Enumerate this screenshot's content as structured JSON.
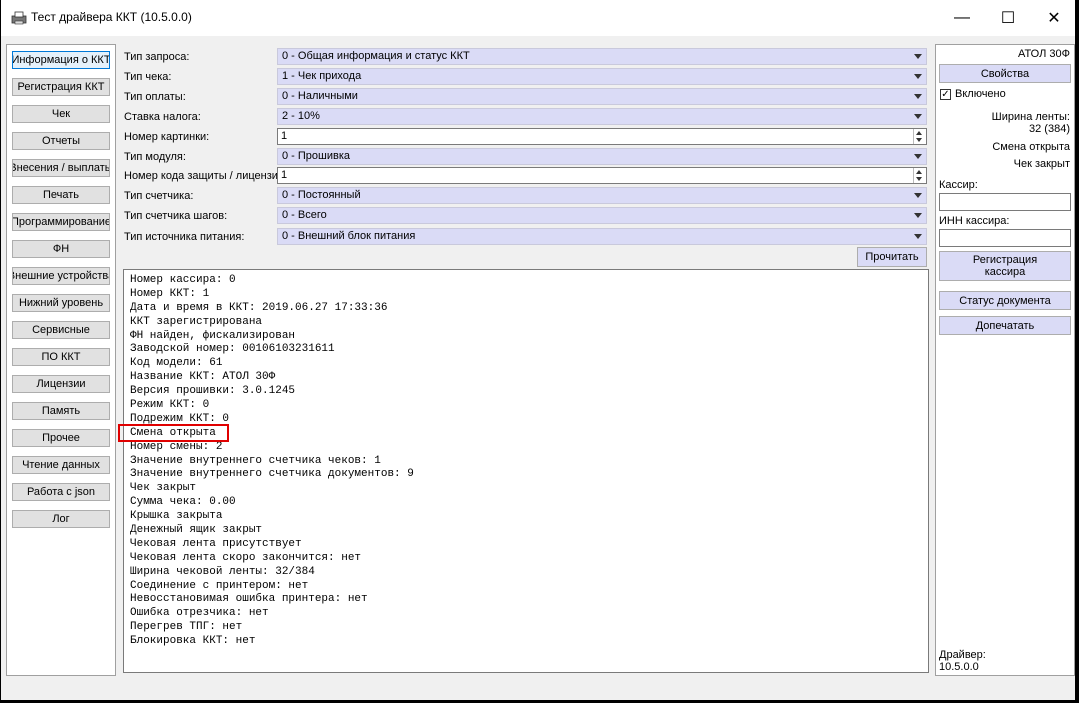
{
  "window": {
    "title": "Тест драйвера ККТ (10.5.0.0)",
    "minimize": "—",
    "maximize": "☐",
    "close": "✕"
  },
  "nav": {
    "items": [
      {
        "label": "Информация о ККТ",
        "active": true
      },
      {
        "label": "Регистрация ККТ"
      },
      {
        "label": "Чек"
      },
      {
        "label": "Отчеты"
      },
      {
        "label": "Внесения / выплаты"
      },
      {
        "label": "Печать"
      },
      {
        "label": "Программирование"
      },
      {
        "label": "ФН"
      },
      {
        "label": "Внешние устройства"
      },
      {
        "label": "Нижний уровень"
      },
      {
        "label": "Сервисные"
      },
      {
        "label": "ПО ККТ"
      },
      {
        "label": "Лицензии"
      },
      {
        "label": "Память"
      },
      {
        "label": "Прочее"
      },
      {
        "label": "Чтение данных"
      },
      {
        "label": "Работа с json"
      },
      {
        "label": "Лог"
      }
    ]
  },
  "form": {
    "fields": [
      {
        "label": "Тип запроса:",
        "value": "0 - Общая информация и статус ККТ",
        "kind": "combo"
      },
      {
        "label": "Тип чека:",
        "value": "1 - Чек прихода",
        "kind": "combo"
      },
      {
        "label": "Тип оплаты:",
        "value": "0 - Наличными",
        "kind": "combo"
      },
      {
        "label": "Ставка налога:",
        "value": "2 - 10%",
        "kind": "combo"
      },
      {
        "label": "Номер картинки:",
        "value": "1",
        "kind": "spin"
      },
      {
        "label": "Тип модуля:",
        "value": "0 - Прошивка",
        "kind": "combo"
      },
      {
        "label": "Номер кода защиты / лицензии:",
        "value": "1",
        "kind": "spin"
      },
      {
        "label": "Тип счетчика:",
        "value": "0 - Постоянный",
        "kind": "combo"
      },
      {
        "label": "Тип счетчика шагов:",
        "value": "0 - Всего",
        "kind": "combo"
      },
      {
        "label": "Тип источника питания:",
        "value": "0 - Внешний блок питания",
        "kind": "combo"
      }
    ],
    "read_button": "Прочитать"
  },
  "output": {
    "lines": [
      "Номер кассира: 0",
      "Номер ККТ: 1",
      "Дата и время в ККТ: 2019.06.27 17:33:36",
      "ККТ зарегистрирована",
      "ФН найден, фискализирован",
      "Заводской номер: 00106103231611",
      "Код модели: 61",
      "Название ККТ: АТОЛ 30Ф",
      "Версия прошивки: 3.0.1245",
      "Режим ККТ: 0",
      "Подрежим ККТ: 0",
      "Смена открыта",
      "Номер смены: 2",
      "Значение внутреннего счетчика чеков: 1",
      "Значение внутреннего счетчика документов: 9",
      "Чек закрыт",
      "Сумма чека: 0.00",
      "Крышка закрыта",
      "Денежный ящик закрыт",
      "Чековая лента присутствует",
      "Чековая лента скоро закончится: нет",
      "Ширина чековой ленты: 32/384",
      "Соединение с принтером: нет",
      "Невосстановимая ошибка принтера: нет",
      "Ошибка отрезчика: нет",
      "Перегрев ТПГ: нет",
      "Блокировка ККТ: нет"
    ],
    "highlight_color": "#e00000"
  },
  "right": {
    "model": "АТОЛ 30Ф",
    "properties_button": "Свойства",
    "enabled_label": "Включено",
    "enabled_checked": true,
    "enabled_check_glyph": "✓",
    "tape_width": "Ширина ленты:\n32 (384)",
    "shift_status": "Смена открыта",
    "receipt_status": "Чек закрыт",
    "cashier_label": "Кассир:",
    "cashier_value": "",
    "cashier_inn_label": "ИНН кассира:",
    "cashier_inn_value": "",
    "register_cashier_button": "Регистрация\nкассира",
    "doc_status_button": "Статус документа",
    "reprint_button": "Допечатать",
    "driver_version": "Драйвер:\n10.5.0.0"
  },
  "colors": {
    "accent": "#0078d7",
    "combo_bg": "#dadbf6"
  }
}
